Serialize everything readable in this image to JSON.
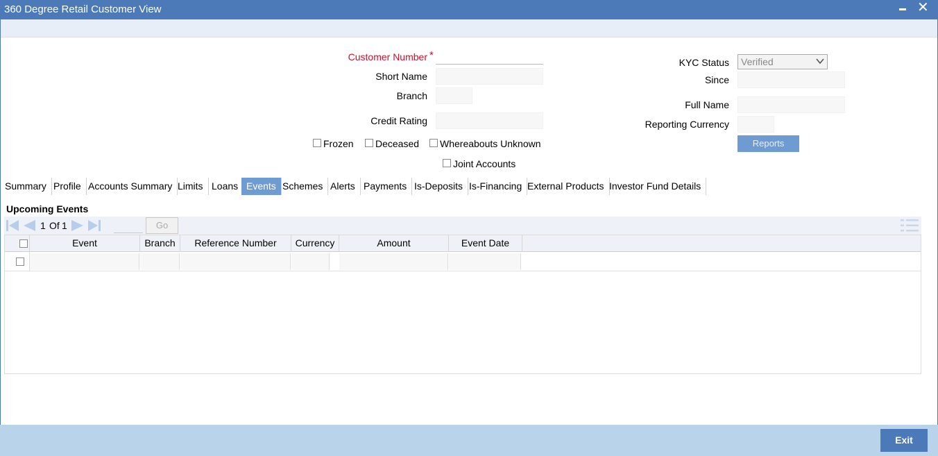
{
  "window": {
    "title": "360 Degree Retail Customer View",
    "minimize_icon": "minimize-icon",
    "close_glyph": "✕"
  },
  "customer": {
    "customer_number_label": "Customer Number",
    "customer_number_value": "",
    "short_name_label": "Short Name",
    "short_name_value": "",
    "branch_label": "Branch",
    "branch_value": "",
    "credit_rating_label": "Credit Rating",
    "credit_rating_value": "",
    "kyc_status_label": "KYC Status",
    "kyc_status_value": "Verified",
    "since_label": "Since",
    "since_value": "",
    "full_name_label": "Full Name",
    "full_name_value": "",
    "reporting_currency_label": "Reporting Currency",
    "reporting_currency_value": "",
    "required_marker": "*"
  },
  "flags": {
    "frozen": "Frozen",
    "deceased": "Deceased",
    "whereabouts_unknown": "Whereabouts Unknown",
    "joint_accounts": "Joint Accounts"
  },
  "buttons": {
    "reports": "Reports",
    "exit": "Exit",
    "go": "Go"
  },
  "tabs": [
    {
      "label": "Summary",
      "active": false
    },
    {
      "label": "Profile",
      "active": false
    },
    {
      "label": "Accounts Summary",
      "active": false
    },
    {
      "label": "Limits",
      "active": false
    },
    {
      "label": "Loans",
      "active": false
    },
    {
      "label": "Events",
      "active": true
    },
    {
      "label": "Schemes",
      "active": false
    },
    {
      "label": "Alerts",
      "active": false
    },
    {
      "label": "Payments",
      "active": false
    },
    {
      "label": "Is-Deposits",
      "active": false
    },
    {
      "label": "Is-Financing",
      "active": false
    },
    {
      "label": "External Products",
      "active": false
    },
    {
      "label": "Investor Fund Details",
      "active": false
    }
  ],
  "events": {
    "section_title": "Upcoming Events",
    "pager": {
      "current": "1",
      "of_label": "Of",
      "total": "1",
      "page_input": ""
    },
    "columns": [
      "Event",
      "Branch",
      "Reference Number",
      "Currency",
      "Amount",
      "Event Date"
    ],
    "rows": [
      [
        "",
        "",
        "",
        "",
        "",
        ""
      ]
    ]
  },
  "colors": {
    "accent": "#4c7ab8",
    "tab_active": "#6e9bd1",
    "footer": "#b9d3ea",
    "required": "#c8102e"
  }
}
